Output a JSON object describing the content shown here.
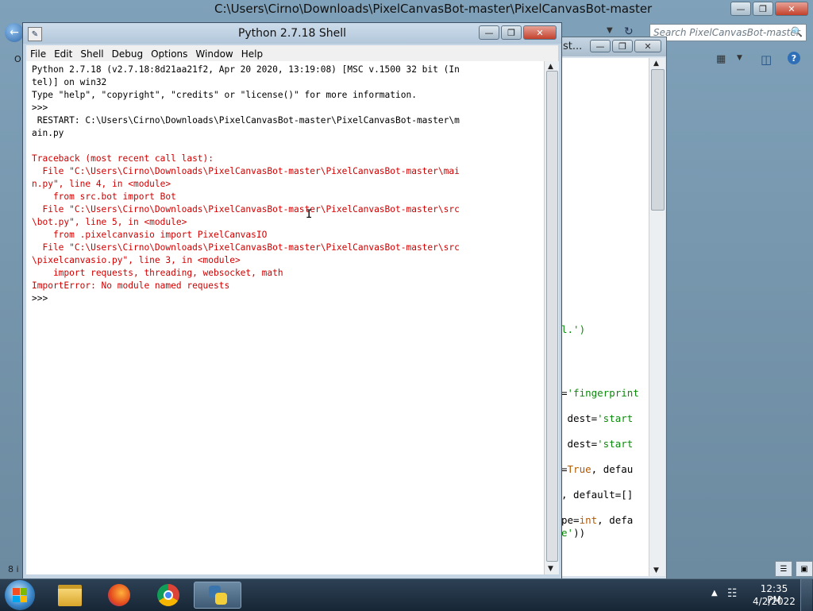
{
  "explorer": {
    "title": "C:\\Users\\Cirno\\Downloads\\PixelCanvasBot-master\\PixelCanvasBot-master",
    "search_placeholder": "Search PixelCanvasBot-master",
    "left_strip_label": "O",
    "status_left": "8 i"
  },
  "editor": {
    "title_fragment": "st...",
    "code_lines": [
      {
        "pre": "",
        "str": "l.')",
        "post": ""
      },
      {
        "pre": "=",
        "str": "'fingerprint",
        "post": ""
      },
      {
        "pre": " dest=",
        "str": "'start",
        "post": ""
      },
      {
        "pre": " dest=",
        "str": "'start",
        "post": ""
      },
      {
        "pre": "=",
        "kw": "True",
        "post": ", defau"
      },
      {
        "pre": ", default=[]",
        "post": ""
      },
      {
        "pre": "pe=",
        "kw": "int",
        "post": ", defa"
      },
      {
        "pre": "",
        "str": "e'",
        "post": "))"
      }
    ]
  },
  "shell": {
    "title": "Python 2.7.18 Shell",
    "menu": [
      "File",
      "Edit",
      "Shell",
      "Debug",
      "Options",
      "Window",
      "Help"
    ],
    "lines": [
      {
        "type": "out",
        "text": "Python 2.7.18 (v2.7.18:8d21aa21f2, Apr 20 2020, 13:19:08) [MSC v.1500 32 bit (In"
      },
      {
        "type": "out",
        "text": "tel)] on win32"
      },
      {
        "type": "out",
        "text": "Type \"help\", \"copyright\", \"credits\" or \"license()\" for more information."
      },
      {
        "type": "out",
        "text": ">>> "
      },
      {
        "type": "out",
        "text": " RESTART: C:\\Users\\Cirno\\Downloads\\PixelCanvasBot-master\\PixelCanvasBot-master\\m"
      },
      {
        "type": "out",
        "text": "ain.py"
      },
      {
        "type": "out",
        "text": ""
      },
      {
        "type": "err",
        "text": "Traceback (most recent call last):"
      },
      {
        "type": "err",
        "text": "  File \"C:\\Users\\Cirno\\Downloads\\PixelCanvasBot-master\\PixelCanvasBot-master\\mai"
      },
      {
        "type": "err",
        "text": "n.py\", line 4, in <module>"
      },
      {
        "type": "err",
        "text": "    from src.bot import Bot"
      },
      {
        "type": "err",
        "text": "  File \"C:\\Users\\Cirno\\Downloads\\PixelCanvasBot-master\\PixelCanvasBot-master\\src"
      },
      {
        "type": "err",
        "text": "\\bot.py\", line 5, in <module>"
      },
      {
        "type": "err",
        "text": "    from .pixelcanvasio import PixelCanvasIO"
      },
      {
        "type": "err",
        "text": "  File \"C:\\Users\\Cirno\\Downloads\\PixelCanvasBot-master\\PixelCanvasBot-master\\src"
      },
      {
        "type": "err",
        "text": "\\pixelcanvasio.py\", line 3, in <module>"
      },
      {
        "type": "err",
        "text": "    import requests, threading, websocket, math"
      },
      {
        "type": "err",
        "text": "ImportError: No module named requests"
      },
      {
        "type": "out",
        "text": ">>> "
      }
    ]
  },
  "taskbar": {
    "apps": [
      "windows-explorer",
      "firefox",
      "chrome",
      "python-idle"
    ],
    "active_app": "python-idle",
    "clock_time": "12:35 PM",
    "clock_date": "4/2/2022"
  }
}
